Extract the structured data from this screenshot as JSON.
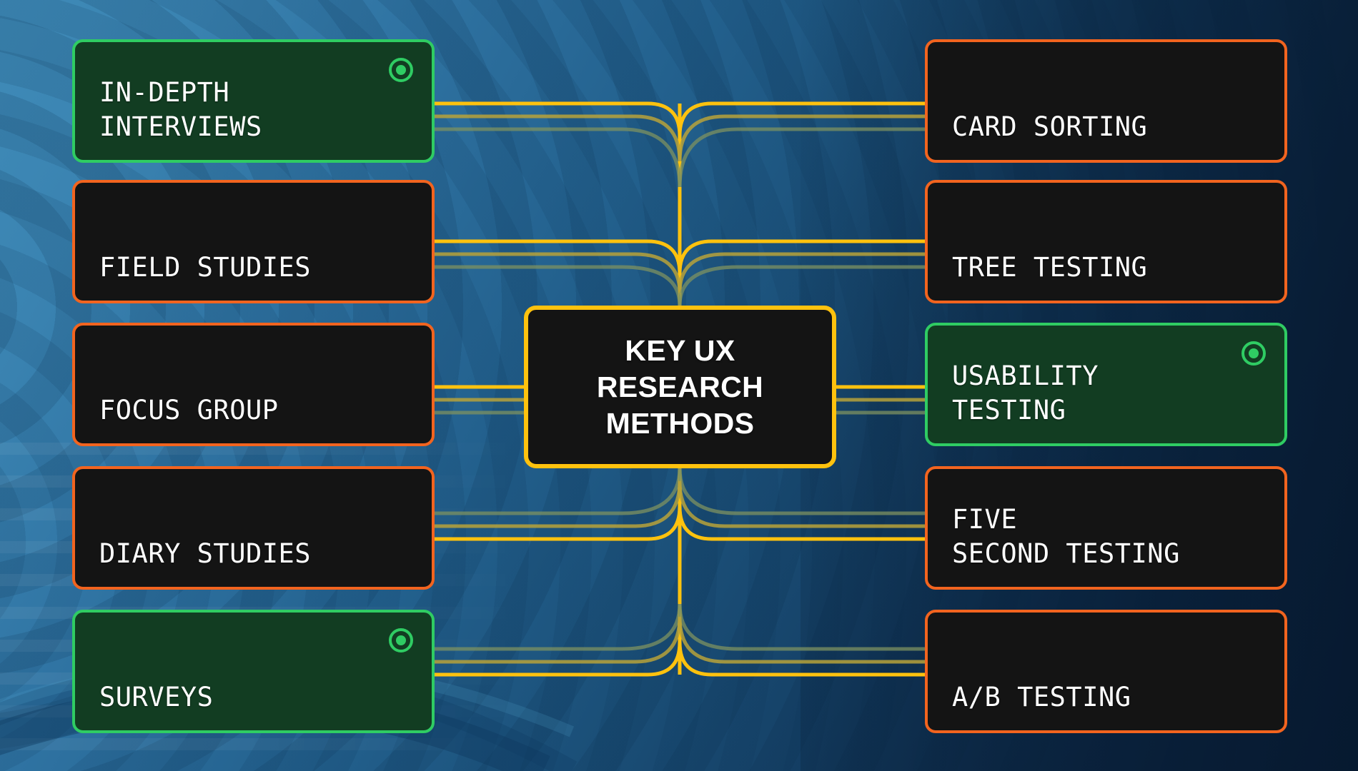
{
  "diagram": {
    "title": "Key UX Research Methods mind map",
    "center": {
      "text": "KEY UX\nRESEARCH\nMETHODS",
      "border_color": "#ffc20e",
      "fill_color": "#141414"
    },
    "colors": {
      "accent_yellow": "#ffc20e",
      "orange": "#f2641f",
      "green": "#2fcc63",
      "green_fill": "#123d22",
      "card_fill": "#141414",
      "text": "#ffffff",
      "bg_light_blue": "#3f8bb8",
      "bg_dark_navy": "#0c2440"
    },
    "left_nodes": [
      {
        "text": "IN-DEPTH\nINTERVIEWS",
        "variant": "green",
        "selected": true,
        "icon": "radio-selected-icon"
      },
      {
        "text": "FIELD STUDIES",
        "variant": "orange",
        "selected": false,
        "icon": ""
      },
      {
        "text": "FOCUS GROUP",
        "variant": "orange",
        "selected": false,
        "icon": ""
      },
      {
        "text": "DIARY STUDIES",
        "variant": "orange",
        "selected": false,
        "icon": ""
      },
      {
        "text": "SURVEYS",
        "variant": "green",
        "selected": true,
        "icon": "radio-selected-icon"
      }
    ],
    "right_nodes": [
      {
        "text": "CARD SORTING",
        "variant": "orange",
        "selected": false,
        "icon": ""
      },
      {
        "text": "TREE TESTING",
        "variant": "orange",
        "selected": false,
        "icon": ""
      },
      {
        "text": "USABILITY\nTESTING",
        "variant": "green",
        "selected": true,
        "icon": "radio-selected-icon"
      },
      {
        "text": "FIVE\nSECOND TESTING",
        "variant": "orange",
        "selected": false,
        "icon": ""
      },
      {
        "text": "A/B TESTING",
        "variant": "orange",
        "selected": false,
        "icon": ""
      }
    ]
  }
}
